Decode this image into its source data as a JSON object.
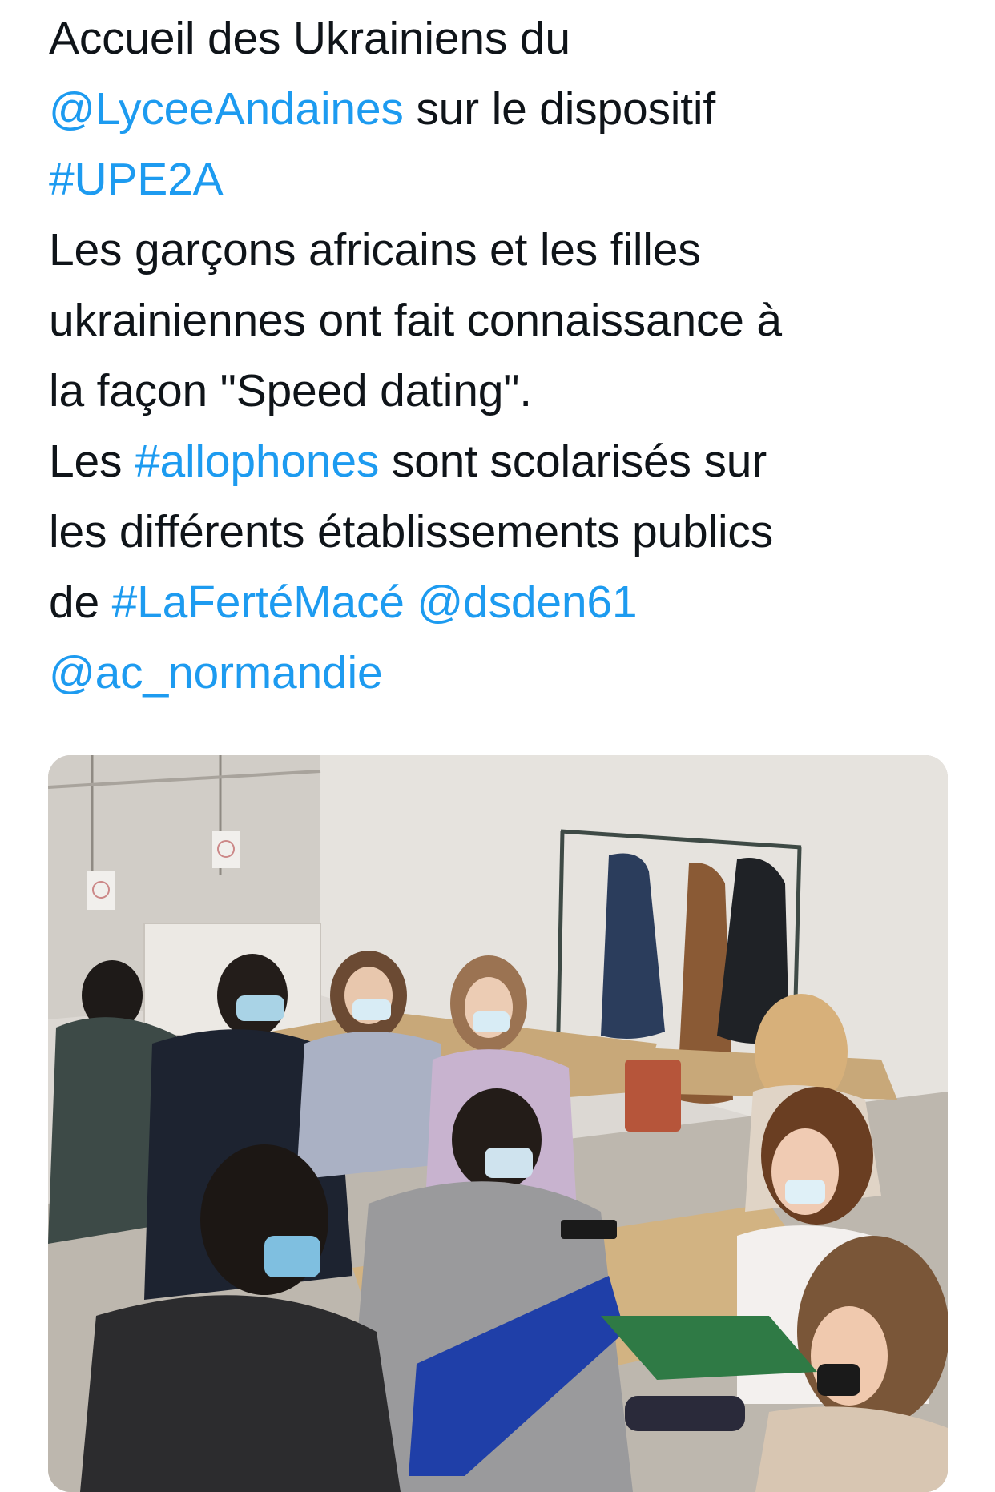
{
  "tweet": {
    "lines": [
      [
        {
          "text": "Accueil des Ukrainiens du",
          "link": false
        }
      ],
      [
        {
          "text": "@LyceeAndaines",
          "link": true
        },
        {
          "text": " sur le dispositif",
          "link": false
        }
      ],
      [
        {
          "text": "#UPE2A",
          "link": true
        }
      ],
      [
        {
          "text": "Les garçons africains et les filles",
          "link": false
        }
      ],
      [
        {
          "text": "ukrainiennes ont fait connaissance à",
          "link": false
        }
      ],
      [
        {
          "text": "la façon \"Speed dating\".",
          "link": false
        }
      ],
      [
        {
          "text": "Les ",
          "link": false
        },
        {
          "text": "#allophones",
          "link": true
        },
        {
          "text": " sont scolarisés sur",
          "link": false
        }
      ],
      [
        {
          "text": "les différents établissements publics",
          "link": false
        }
      ],
      [
        {
          "text": "de ",
          "link": false
        },
        {
          "text": "#LaFertéMacé",
          "link": true
        },
        {
          "text": " ",
          "link": false
        },
        {
          "text": "@dsden61",
          "link": true
        }
      ],
      [
        {
          "text": "@ac_normandie",
          "link": true
        }
      ]
    ]
  },
  "colors": {
    "text": "#0f1419",
    "link": "#1d9bf0",
    "background": "#ffffff"
  },
  "media": {
    "icon": "classroom-photo"
  }
}
